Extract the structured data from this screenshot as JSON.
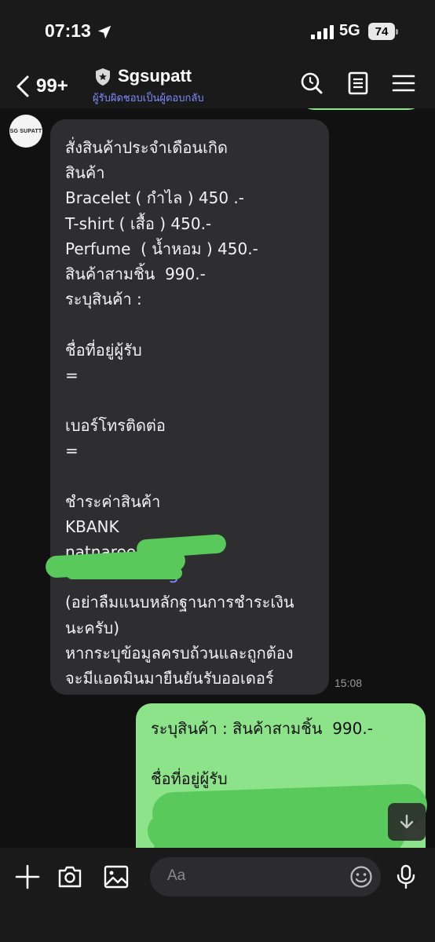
{
  "status_bar": {
    "time": "07:13",
    "network": "5G",
    "battery": "74"
  },
  "header": {
    "unread_count": "99+",
    "title": "Sgsupatt",
    "subtitle": "ผู้รับผิดชอบเป็นผู้ตอบกลับ"
  },
  "chat": {
    "avatar_text": "SG SUPATT",
    "incoming": {
      "lines": [
        "สั่งสินค้าประจำเดือนเกิด",
        "สินค้า",
        "Bracelet ( กำไล ) 450 .-",
        "T-shirt ( เสื้อ ) 450.-",
        "Perfume  ( น้ำหอม ) 450.-",
        "สินค้าสามชิ้น  990.-",
        "ระบุสินค้า :",
        "",
        "ชื่อที่อยู่ผู้รับ",
        "=",
        "",
        "เบอร์โทรติดต่อ",
        "=",
        "",
        "ชำระค่าสินค้า",
        "KBANK",
        "natnaree",
        "5",
        "(อย่าลืมแนบหลักฐานการชำระเงิน",
        "นะครับ)",
        "หากระบุข้อมูลครบถ้วนและถูกต้อง",
        "จะมีแอดมินมายืนยันรับออเดอร์"
      ],
      "time": "15:08"
    },
    "outgoing": {
      "lines": [
        "ระบุสินค้า : สินค้าสามชิ้น  990.-",
        "",
        "ชื่อที่อยู่ผู้รับ"
      ]
    }
  },
  "input_bar": {
    "placeholder": "Aa"
  },
  "colors": {
    "accent_link": "#7d8bff",
    "outgoing_bubble": "#8de38a",
    "incoming_bubble": "#2e2e30",
    "redaction": "#58c95a"
  },
  "icons": [
    "location-arrow-icon",
    "signal-icon",
    "back-chevron-icon",
    "shield-icon",
    "search-icon",
    "notes-icon",
    "menu-icon",
    "plus-icon",
    "camera-icon",
    "image-icon",
    "emoji-icon",
    "microphone-icon",
    "scroll-down-icon"
  ]
}
